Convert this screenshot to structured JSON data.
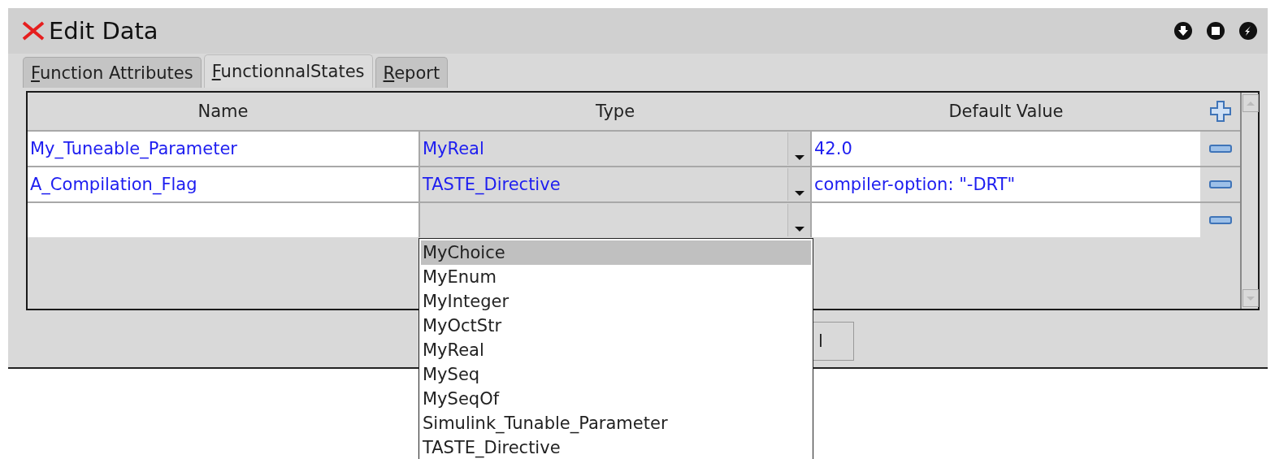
{
  "window": {
    "title": "Edit Data"
  },
  "tabs": [
    {
      "label": "Function Attributes",
      "selected": false
    },
    {
      "label": "FunctionnalStates",
      "selected": true
    },
    {
      "label": "Report",
      "selected": false
    }
  ],
  "table": {
    "columns": [
      "Name",
      "Type",
      "Default Value"
    ],
    "rows": [
      {
        "name": "My_Tuneable_Parameter",
        "type": "MyReal",
        "default": "42.0"
      },
      {
        "name": "A_Compilation_Flag",
        "type": "TASTE_Directive",
        "default": "compiler-option: \"-DRT\""
      },
      {
        "name": "",
        "type": "",
        "default": ""
      }
    ]
  },
  "type_dropdown": {
    "items": [
      {
        "label": "MyChoice",
        "selected": true
      },
      {
        "label": "MyEnum",
        "selected": false
      },
      {
        "label": "MyInteger",
        "selected": false
      },
      {
        "label": "MyOctStr",
        "selected": false
      },
      {
        "label": "MyReal",
        "selected": false
      },
      {
        "label": "MySeq",
        "selected": false
      },
      {
        "label": "MySeqOf",
        "selected": false
      },
      {
        "label": "Simulink_Tunable_Parameter",
        "selected": false
      },
      {
        "label": "TASTE_Directive",
        "selected": false
      }
    ]
  },
  "buttons": [
    "l"
  ]
}
